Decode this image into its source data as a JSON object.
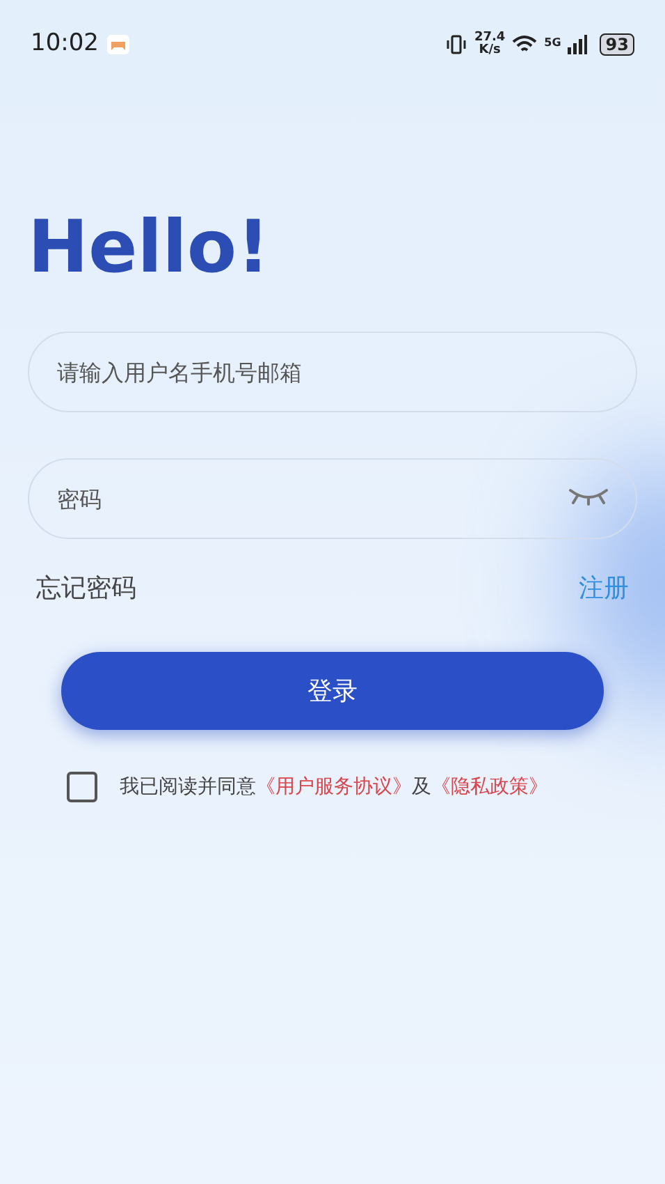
{
  "status_bar": {
    "time": "10:02",
    "speed_value": "27.4",
    "speed_unit": "K/s",
    "network": "5G",
    "battery": "93"
  },
  "greeting": "Hello!",
  "username_field": {
    "placeholder": "请输入用户名手机号邮箱"
  },
  "password_field": {
    "placeholder": "密码",
    "visible": false
  },
  "forgot_password": "忘记密码",
  "register": "注册",
  "login_button": "登录",
  "agreement": {
    "checked": false,
    "text": "我已阅读并同意",
    "link_1": "《用户服务协议》",
    "joiner": "及",
    "link_2": "《隐私政策》"
  }
}
